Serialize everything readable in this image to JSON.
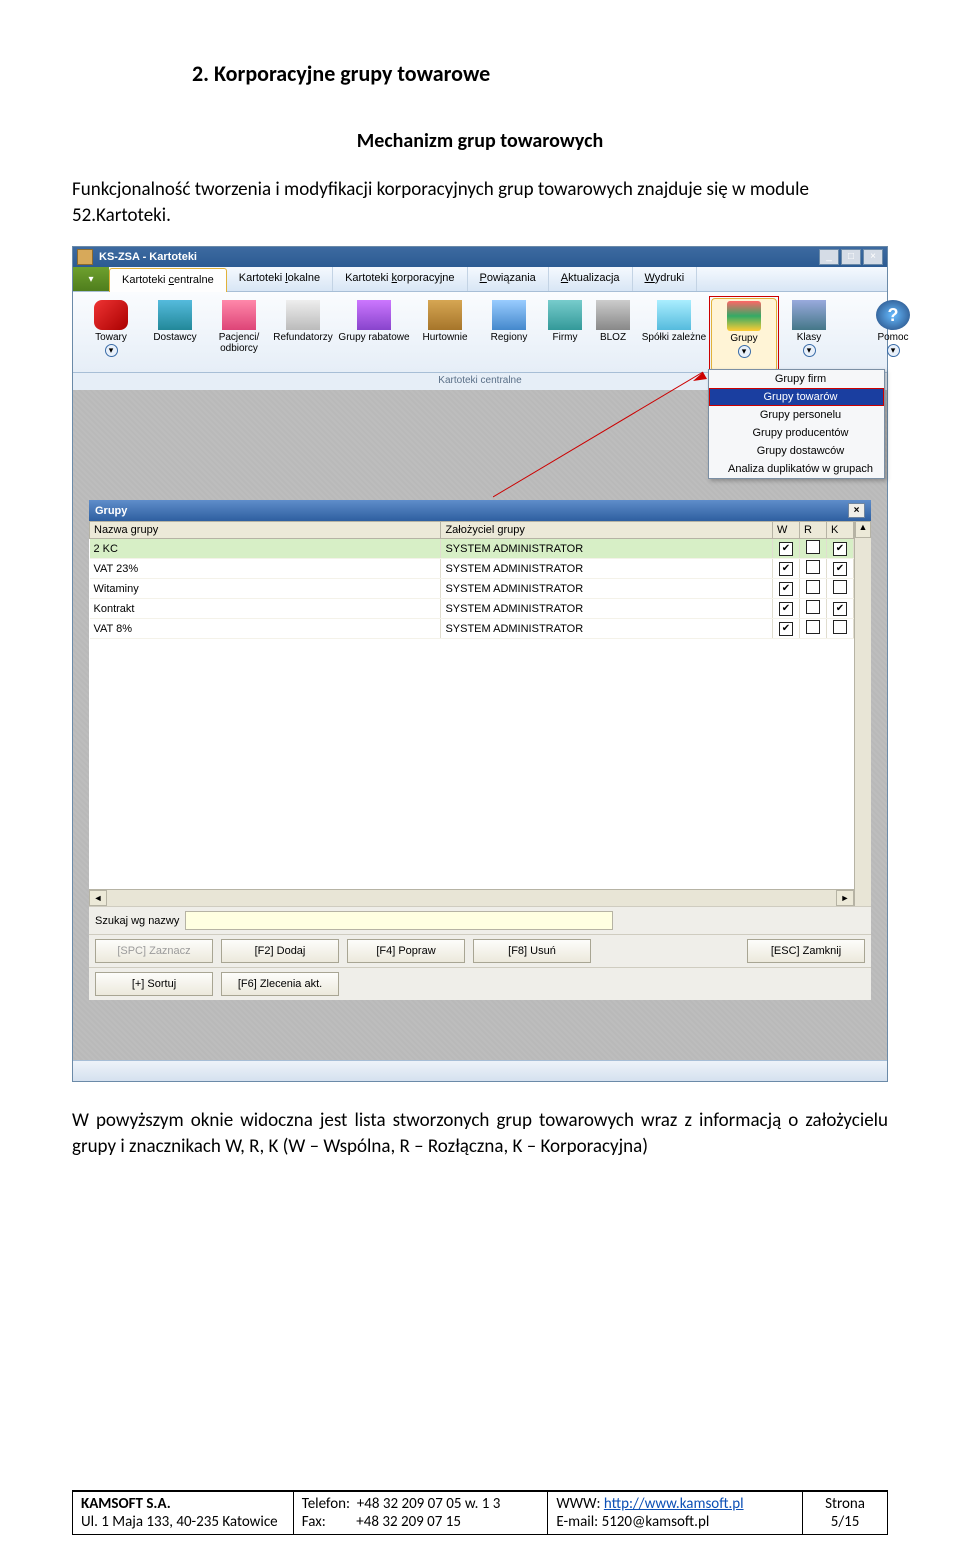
{
  "heading": "2.  Korporacyjne grupy towarowe",
  "subtitle": "Mechanizm grup towarowych",
  "intro": "Funkcjonalność tworzenia i modyfikacji korporacyjnych grup towarowych znajduje się w module 52.Kartoteki.",
  "app_title": "KS-ZSA - Kartoteki",
  "win_min": "_",
  "win_max": "□",
  "win_close": "×",
  "app_btn": "▾",
  "menu": {
    "centralne": "Kartoteki centralne",
    "lokalne": "Kartoteki lokalne",
    "korporacyjne": "Kartoteki korporacyjne",
    "powiazania": "Powiązania",
    "aktualizacja": "Aktualizacja",
    "wydruki": "Wydruki"
  },
  "menu_u": {
    "centralne": "c",
    "lokalne": "l",
    "korporacyjne": "k",
    "powiazania": "P",
    "aktualizacja": "A",
    "wydruki": "W"
  },
  "ribbon": {
    "towary": "Towary",
    "dostawcy": "Dostawcy",
    "pacjenci": "Pacjenci/\nodbiorcy",
    "refundatorzy": "Refundatorzy",
    "grupyRabatowe": "Grupy rabatowe",
    "hurtownie": "Hurtownie",
    "regiony": "Regiony",
    "firmy": "Firmy",
    "bloz": "BLOZ",
    "spolki": "Spółki zależne",
    "grupy": "Grupy",
    "klasy": "Klasy",
    "pomoc": "Pomoc",
    "caption": "Kartoteki centralne",
    "help_q": "?"
  },
  "dropdown": {
    "firm": "Grupy firm",
    "towarow": "Grupy towarów",
    "personelu": "Grupy personelu",
    "producentow": "Grupy producentów",
    "dostawcow": "Grupy dostawców",
    "analiza": "Analiza duplikatów w grupach"
  },
  "panel": {
    "title": "Grupy",
    "col_nazwa": "Nazwa grupy",
    "col_zalozyciel": "Założyciel grupy",
    "col_w": "W",
    "col_r": "R",
    "col_k": "K",
    "rows": [
      {
        "nazwa": "2 KC",
        "zal": "SYSTEM ADMINISTRATOR",
        "w": true,
        "r": false,
        "k": true
      },
      {
        "nazwa": "VAT 23%",
        "zal": "SYSTEM ADMINISTRATOR",
        "w": true,
        "r": false,
        "k": true
      },
      {
        "nazwa": "Witaminy",
        "zal": "SYSTEM ADMINISTRATOR",
        "w": true,
        "r": false,
        "k": false
      },
      {
        "nazwa": "Kontrakt",
        "zal": "SYSTEM ADMINISTRATOR",
        "w": true,
        "r": false,
        "k": true
      },
      {
        "nazwa": "VAT 8%",
        "zal": "SYSTEM ADMINISTRATOR",
        "w": true,
        "r": false,
        "k": false
      }
    ],
    "search_label": "Szukaj wg nazwy",
    "btn_zaznacz": "[SPC] Zaznacz",
    "btn_dodaj": "[F2] Dodaj",
    "btn_popraw": "[F4] Popraw",
    "btn_usun": "[F8] Usuń",
    "btn_zamknij": "[ESC] Zamknij",
    "btn_sortuj": "[+] Sortuj",
    "btn_zlecenia": "[F6] Zlecenia akt.",
    "scroll_up": "▲",
    "scroll_left": "◄",
    "scroll_right": "►"
  },
  "after_text": "W powyższym okniе widoczna jest lista stworzonych grup towarowych wraz z informacją o założycielu grupy i znacznikach W, R, K (W – Wspólna, R – Rozłączna, K – Korporacyjna)",
  "footer": {
    "company": "KAMSOFT S.A.",
    "addr": "Ul. 1 Maja 133, 40-235 Katowice",
    "tel_l": "Telefon:",
    "tel_v": "+48 32 209 07 05 w. 1 3",
    "fax_l": "Fax:",
    "fax_v": "+48 32 209 07 15",
    "www_l": "WWW: ",
    "www_v": "http://www.kamsoft.pl",
    "email_l": "E-mail: ",
    "email_v": "5120@kamsoft.pl",
    "strona": "Strona",
    "page": "5/15"
  }
}
